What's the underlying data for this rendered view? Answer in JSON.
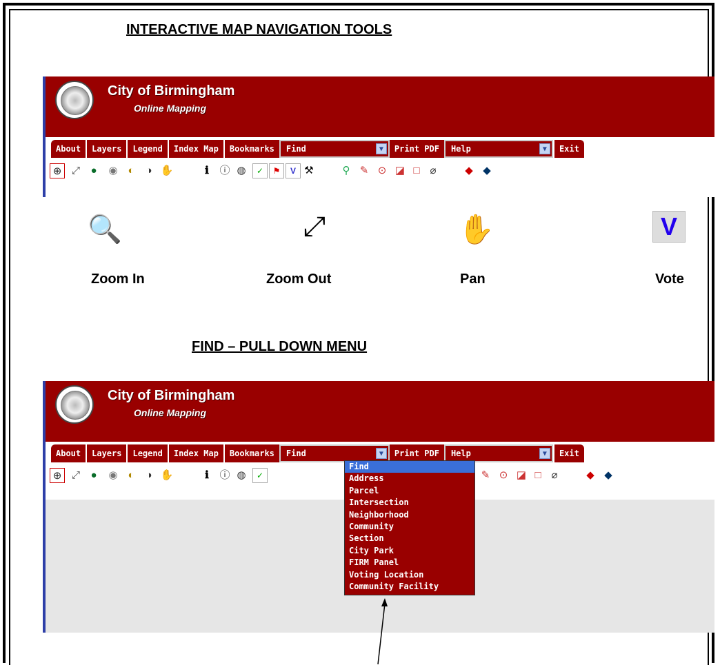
{
  "headings": {
    "tools": "INTERACTIVE MAP NAVIGATION TOOLS",
    "find": "FIND – PULL DOWN MENU"
  },
  "app": {
    "title": "City of Birmingham",
    "subtitle": "Online Mapping"
  },
  "tabs": {
    "about": "About",
    "layers": "Layers",
    "legend": "Legend",
    "index_map": "Index Map",
    "bookmarks": "Bookmarks",
    "find_select": "Find",
    "print_pdf": "Print PDF",
    "help_select": "Help",
    "exit": "Exit"
  },
  "toolbar_icons": [
    "zoom-in-icon",
    "zoom-out-icon",
    "globe-icon",
    "identify-icon",
    "zoom-prev-icon",
    "zoom-next-icon",
    "pan-icon",
    "info-icon",
    "info-alt-icon",
    "query-icon",
    "check-icon",
    "flag-icon",
    "vote-icon",
    "hammer-icon",
    "measure-icon",
    "draw-line-icon",
    "circle-icon",
    "select-icon",
    "rectangle-icon",
    "eraser-icon",
    "print-icon",
    "save-icon"
  ],
  "featured_tools": {
    "zoom_in": "Zoom In",
    "zoom_out": "Zoom Out",
    "pan": "Pan",
    "vote": "Vote"
  },
  "find_menu": {
    "options": [
      "Find",
      "Address",
      "Parcel",
      "Intersection",
      "Neighborhood",
      "Community",
      "Section",
      "City Park",
      "FIRM Panel",
      "Voting Location",
      "Community Facility"
    ],
    "selected": "Find"
  },
  "colors": {
    "banner": "#990000",
    "selected": "#3a6fd8",
    "map_bg": "#e6e6e6"
  }
}
